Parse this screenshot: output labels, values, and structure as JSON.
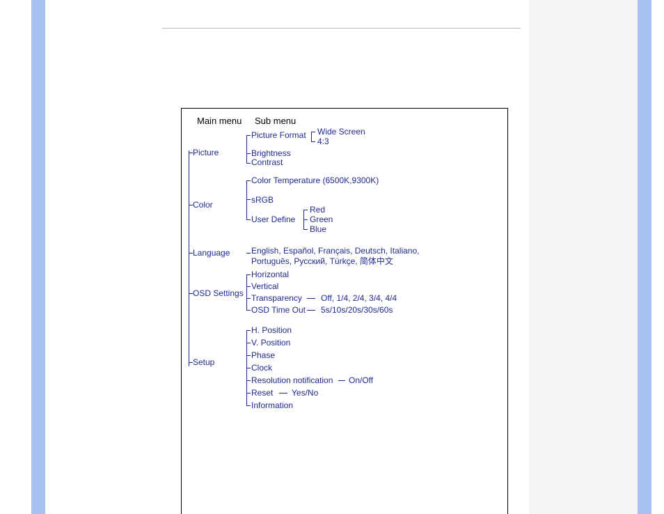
{
  "headers": {
    "main": "Main menu",
    "sub": "Sub menu"
  },
  "main": {
    "picture": "Picture",
    "color": "Color",
    "language": "Language",
    "osd": "OSD Settings",
    "setup": "Setup"
  },
  "picture": {
    "format": "Picture Format",
    "brightness": "Brightness",
    "contrast": "Contrast",
    "format_opts": {
      "wide": "Wide Screen",
      "four_three": "4:3"
    }
  },
  "color": {
    "temp": "Color Temperature (6500K,9300K)",
    "srgb": "sRGB",
    "user_define": "User Define",
    "rgb": {
      "red": "Red",
      "green": "Green",
      "blue": "Blue"
    }
  },
  "language": {
    "values": "English, Español, Français, Deutsch, Italiano, Português, Русский, Türkçe, 简体中文"
  },
  "osd": {
    "horizontal": "Horizontal",
    "vertical": "Vertical",
    "transparency": "Transparency",
    "transparency_values": "Off, 1/4, 2/4, 3/4, 4/4",
    "timeout": "OSD Time Out",
    "timeout_values": "5s/10s/20s/30s/60s"
  },
  "setup": {
    "h_position": "H. Position",
    "v_position": "V. Position",
    "phase": "Phase",
    "clock": "Clock",
    "res_notif": "Resolution notification",
    "res_notif_values": "On/Off",
    "reset": "Reset",
    "reset_values": "Yes/No",
    "information": "Information"
  }
}
